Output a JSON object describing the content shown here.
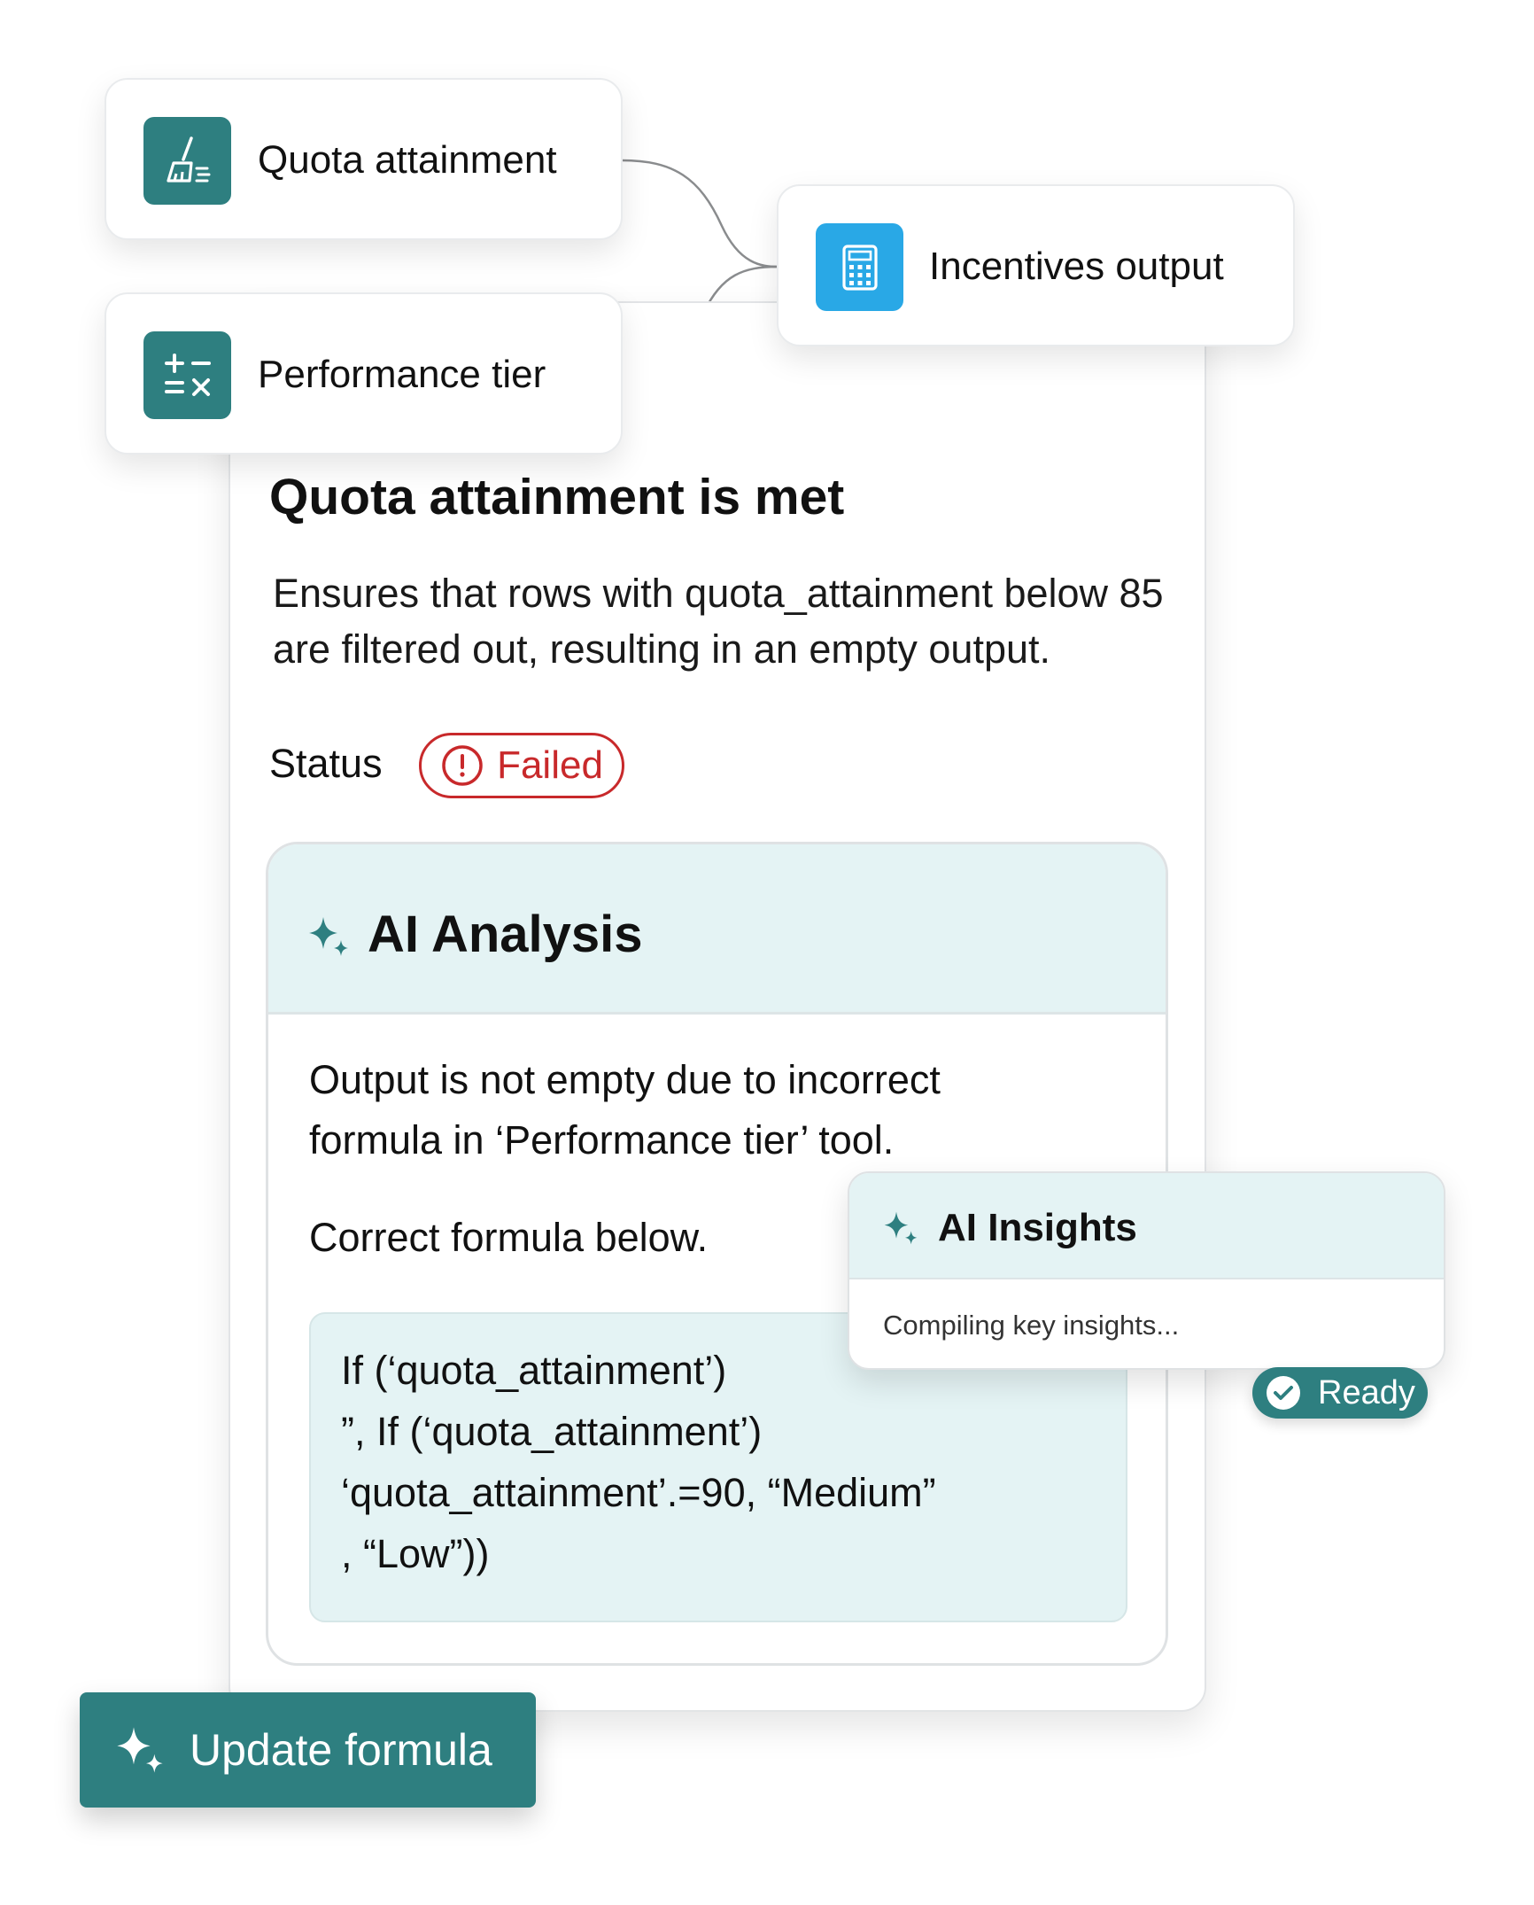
{
  "nodes": {
    "quota": {
      "label": "Quota attainment",
      "icon": "broom-icon",
      "color": "#2e7f80"
    },
    "performance": {
      "label": "Performance tier",
      "icon": "calculator-ops-icon",
      "color": "#2e7f80"
    },
    "incentives": {
      "label": "Incentives output",
      "icon": "calculator-icon",
      "color": "#29a8e6"
    }
  },
  "rule": {
    "title": "Quota attainment is met",
    "description": "Ensures that rows with quota_attainment below 85 are filtered out, resulting in an empty output.",
    "status_label": "Status",
    "status_value": "Failed",
    "status_color": "#c8292b"
  },
  "ai_analysis": {
    "title": "AI Analysis",
    "text1": "Output is not empty due to incorrect formula in ‘Performance tier’ tool.",
    "text2": "Correct formula below.",
    "code": [
      "If (‘quota_attainment’)",
      "”, If  (‘quota_attainment’)",
      "‘quota_attainment’.=90, “Medium”",
      ", “Low”))"
    ]
  },
  "ai_insights": {
    "title": "AI Insights",
    "status": "Compiling key insights...",
    "badge": "Ready"
  },
  "update_button": {
    "label": "Update formula"
  },
  "colors": {
    "accent": "#2e7f80",
    "panel_bg": "#e4f3f4",
    "blue": "#29a8e6"
  }
}
